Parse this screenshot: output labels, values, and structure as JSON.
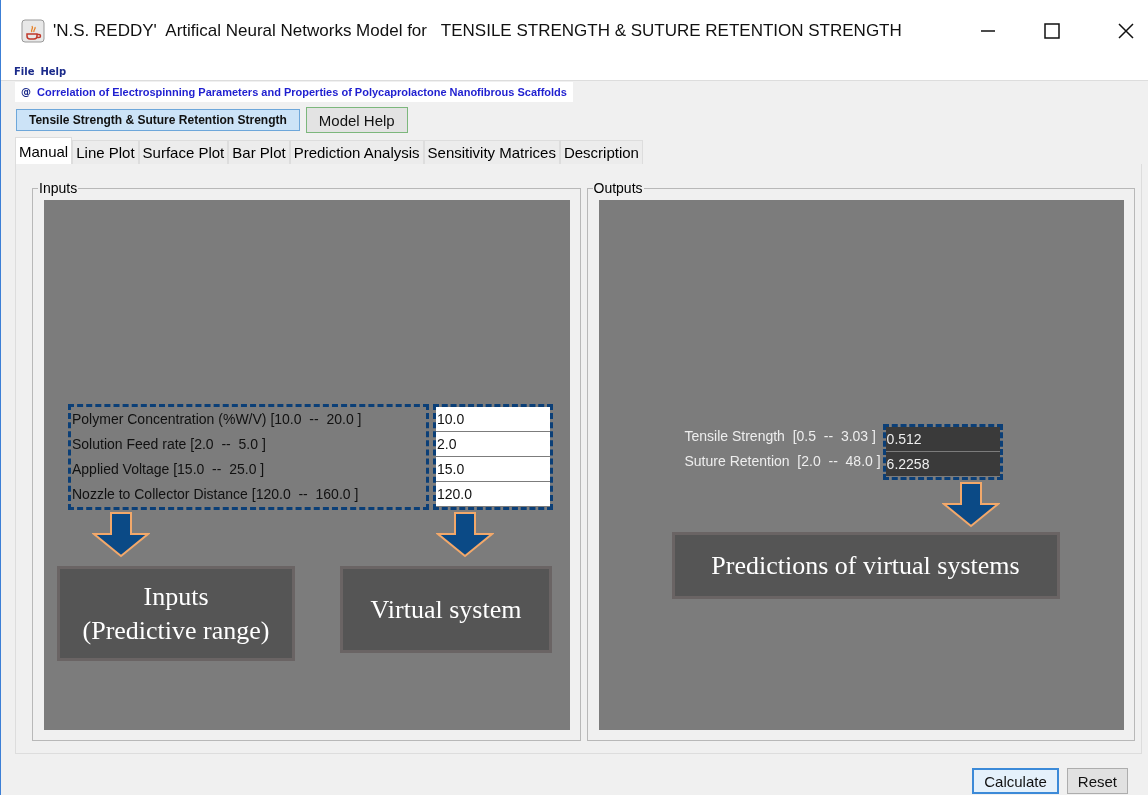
{
  "window": {
    "title": "'N.S. REDDY'  Artifical Neural Networks Model for   TENSILE STRENGTH & SUTURE RETENTION STRENGTH"
  },
  "menu": [
    "File",
    "Help"
  ],
  "banner": {
    "icon": "@",
    "text": "Correlation of Electrospinning Parameters and Properties of Polycaprolactone Nanofibrous Scaffolds"
  },
  "model_buttons": [
    {
      "label": "Tensile Strength & Suture Retention Strength",
      "selected": true
    },
    {
      "label": "Model Help",
      "selected": false
    }
  ],
  "tabs": [
    {
      "label": "Manual",
      "selected": true
    },
    {
      "label": "Line Plot",
      "selected": false
    },
    {
      "label": "Surface Plot",
      "selected": false
    },
    {
      "label": "Bar Plot",
      "selected": false
    },
    {
      "label": "Prediction Analysis",
      "selected": false
    },
    {
      "label": "Sensitivity Matrices",
      "selected": false
    },
    {
      "label": "Description",
      "selected": false
    }
  ],
  "inputs": {
    "title": "Inputs",
    "rows": [
      {
        "label": "Polymer Concentration (%W/V) [10.0  --  20.0 ]",
        "value": "10.0"
      },
      {
        "label": "Solution Feed rate [2.0  --  5.0 ]",
        "value": "2.0"
      },
      {
        "label": "Applied Voltage [15.0  --  25.0 ]",
        "value": "15.0"
      },
      {
        "label": "Nozzle to Collector Distance [120.0  --  160.0 ]",
        "value": "120.0"
      }
    ],
    "callouts": [
      "Inputs\n(Predictive range)",
      "Virtual system"
    ]
  },
  "outputs": {
    "title": "Outputs",
    "rows": [
      {
        "label": "Tensile Strength  [0.5  --  3.03 ]",
        "value": "0.512"
      },
      {
        "label": "Suture Retention  [2.0  --  48.0 ]",
        "value": "6.2258"
      }
    ],
    "callout": "Predictions of virtual systems"
  },
  "buttons": [
    {
      "label": "Calculate",
      "selected": true
    },
    {
      "label": "Reset",
      "selected": false
    }
  ]
}
